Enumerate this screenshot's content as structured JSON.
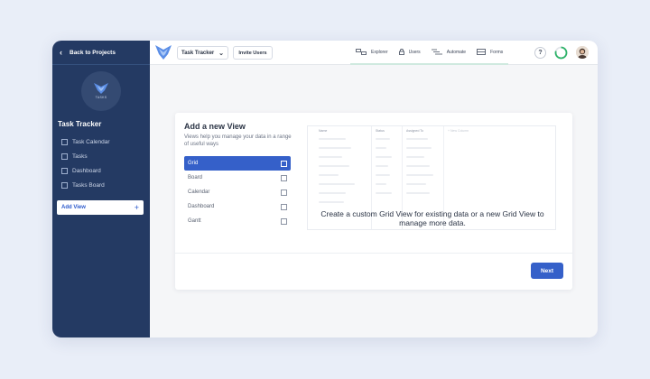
{
  "sidebar": {
    "back_label": "Back to Projects",
    "logo_text": "TASKS",
    "project_title": "Task Tracker",
    "items": [
      {
        "label": "Task Calendar",
        "icon": "calendar-icon"
      },
      {
        "label": "Tasks",
        "icon": "list-icon"
      },
      {
        "label": "Dashboard",
        "icon": "dashboard-icon"
      },
      {
        "label": "Tasks Board",
        "icon": "board-icon"
      }
    ],
    "add_view_label": "Add View",
    "add_view_icon": "plus-icon"
  },
  "topbar": {
    "project_selector": "Task Tracker",
    "invite_label": "Invite Users",
    "tabs": [
      {
        "label": "Explorer",
        "icon": "explorer-icon"
      },
      {
        "label": "Users",
        "icon": "lock-icon"
      },
      {
        "label": "Automate",
        "icon": "automate-icon"
      },
      {
        "label": "Forms",
        "icon": "forms-icon"
      }
    ],
    "help_label": "?"
  },
  "dialog": {
    "title": "Add a new View",
    "description": "Views help you manage your data in a range of useful ways",
    "view_types": [
      {
        "label": "Grid",
        "icon": "grid-icon",
        "selected": true
      },
      {
        "label": "Board",
        "icon": "board-icon",
        "selected": false
      },
      {
        "label": "Calendar",
        "icon": "calendar-icon",
        "selected": false
      },
      {
        "label": "Dashboard",
        "icon": "dashboard-icon",
        "selected": false
      },
      {
        "label": "Gantt",
        "icon": "gantt-icon",
        "selected": false
      }
    ],
    "preview": {
      "columns": [
        "Name",
        "Status",
        "Assigned To",
        "+ New Column"
      ],
      "message": "Create a custom Grid View for existing data or a new Grid View to manage more data."
    },
    "next_label": "Next"
  },
  "colors": {
    "sidebar_bg": "#243a63",
    "accent": "#3560c9",
    "progress_ring": "#2fb36a"
  }
}
